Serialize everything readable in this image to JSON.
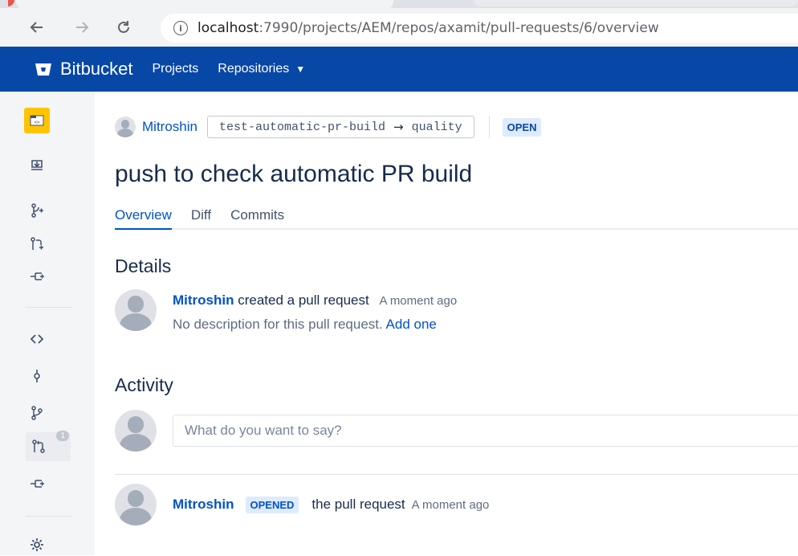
{
  "browser": {
    "url_host": "localhost",
    "url_path": ":7990/projects/AEM/repos/axamit/pull-requests/6/overview",
    "back_icon": "back-arrow-icon",
    "forward_icon": "forward-arrow-icon",
    "reload_icon": "reload-icon",
    "info_icon": "info-icon"
  },
  "header": {
    "logo_text": "Bitbucket",
    "nav": [
      {
        "label": "Projects"
      },
      {
        "label": "Repositories",
        "dropdown": true
      }
    ],
    "color": "#0747a6"
  },
  "sidebar": {
    "items": [
      {
        "icon": "repository-icon",
        "active": true
      },
      {
        "icon": "clone-icon"
      },
      {
        "icon": "create-branch-icon"
      },
      {
        "icon": "create-pull-request-icon"
      },
      {
        "icon": "fork-icon"
      },
      {
        "icon": "source-icon"
      },
      {
        "icon": "commits-icon"
      },
      {
        "icon": "branches-icon"
      },
      {
        "icon": "pull-requests-icon",
        "badge": "1",
        "selected": true
      },
      {
        "icon": "forks-icon"
      },
      {
        "icon": "settings-icon"
      }
    ]
  },
  "pr": {
    "author": "Mitroshin",
    "source_branch": "test-automatic-pr-build",
    "arrow": "→",
    "target_branch": "quality",
    "status": "OPEN",
    "title": "push to check automatic PR build",
    "tabs": [
      {
        "label": "Overview",
        "active": true
      },
      {
        "label": "Diff"
      },
      {
        "label": "Commits"
      }
    ]
  },
  "details": {
    "heading": "Details",
    "author": "Mitroshin",
    "action": "created a pull request",
    "time": "A moment ago",
    "description": "No description for this pull request.",
    "add_link": "Add one"
  },
  "activity": {
    "heading": "Activity",
    "comment_placeholder": "What do you want to say?",
    "event": {
      "author": "Mitroshin",
      "badge": "OPENED",
      "text": "the pull request",
      "time": "A moment ago"
    }
  }
}
